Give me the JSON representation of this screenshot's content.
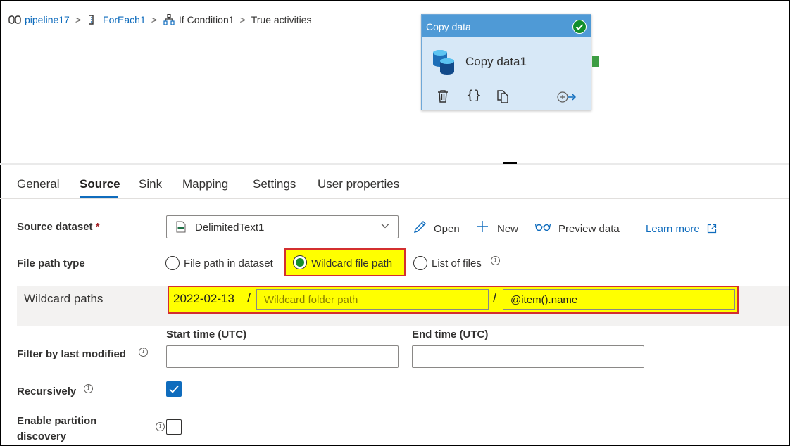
{
  "breadcrumb": {
    "pipeline": "pipeline17",
    "foreach": "ForEach1",
    "condition": "If Condition1",
    "current": "True activities",
    "separator": ">"
  },
  "activity": {
    "type_label": "Copy data",
    "name": "Copy data1",
    "status": "succeeded",
    "header_color": "#4f9ad6",
    "success_color": "#128e2b"
  },
  "tabs": {
    "general": "General",
    "source": "Source",
    "sink": "Sink",
    "mapping": "Mapping",
    "settings": "Settings",
    "user_properties": "User properties",
    "active": "Source"
  },
  "source": {
    "dataset_label": "Source dataset",
    "required_mark": "*",
    "dataset_value": "DelimitedText1",
    "actions": {
      "open": "Open",
      "new": "New",
      "preview": "Preview data",
      "learn_more": "Learn more"
    },
    "file_path_type_label": "File path type",
    "file_path_options": [
      "File path in dataset",
      "Wildcard file path",
      "List of files"
    ],
    "file_path_selected": "Wildcard file path",
    "wildcard_paths_label": "Wildcard paths",
    "wildcard_prefix": "2022-02-13",
    "path_separator": "/",
    "wildcard_folder_placeholder": "Wildcard folder path",
    "wildcard_file_value": "@item().name",
    "filter_label": "Filter by last modified",
    "start_time_label": "Start time (UTC)",
    "end_time_label": "End time (UTC)",
    "recursively_label": "Recursively",
    "recursively_checked": true,
    "partition_label_line1": "Enable partition",
    "partition_label_line2": "discovery",
    "partition_checked": false,
    "info_glyph": "i"
  },
  "colors": {
    "accent": "#0f6cbd",
    "highlight": "#ffff00",
    "highlight_border": "#d32f2f"
  }
}
